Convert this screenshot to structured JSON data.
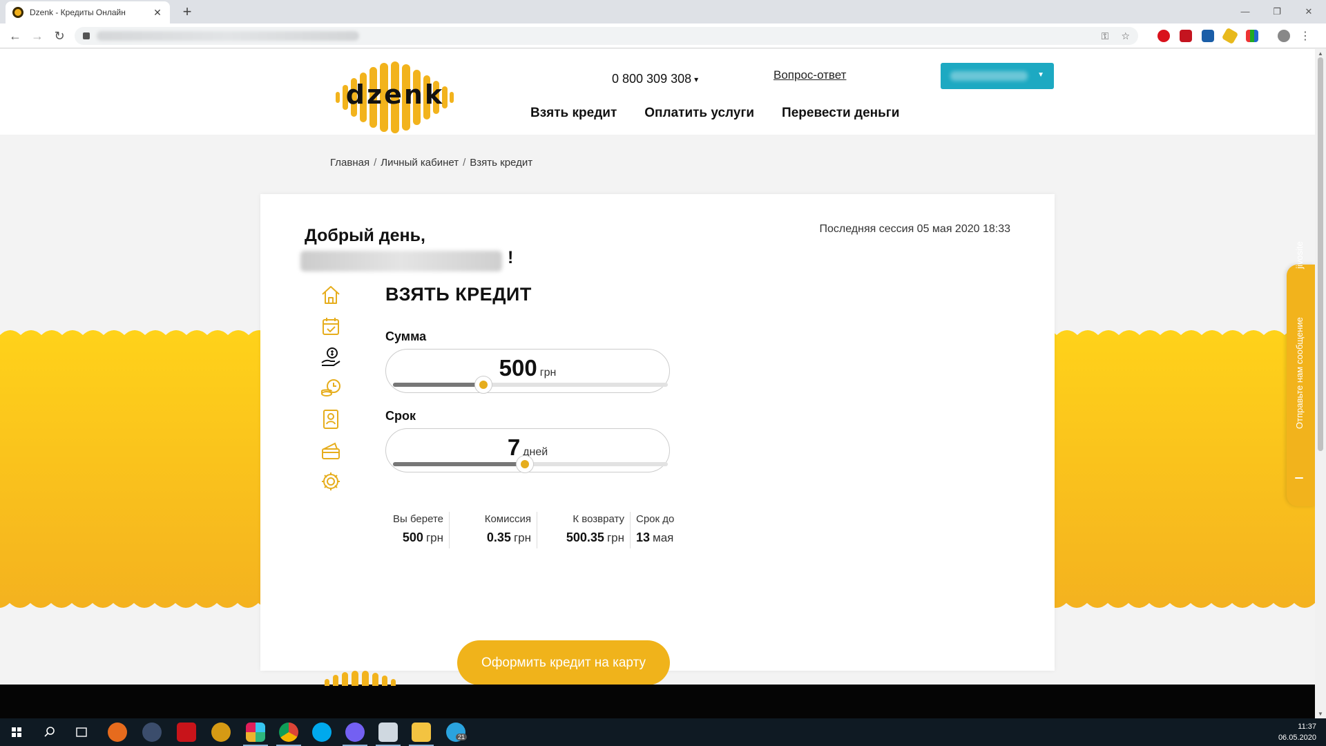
{
  "browser": {
    "tab_title": "Dzenk - Кредиты Онлайн",
    "tab_close": "✕",
    "new_tab": "+",
    "win_minimize": "—",
    "win_restore": "❐",
    "win_close": "✕",
    "back": "←",
    "forward": "→",
    "reload": "↻",
    "key_icon": "⚿",
    "star_icon": "☆",
    "menu_icon": "⋮"
  },
  "header": {
    "logo_text": "dzenk",
    "phone": "0 800 309 308",
    "phone_caret": "▾",
    "faq_link": "Вопрос-ответ",
    "user_caret": "▼",
    "nav": [
      "Взять кредит",
      "Оплатить услуги",
      "Перевести деньги"
    ]
  },
  "breadcrumb": [
    "Главная",
    "Личный кабинет",
    "Взять кредит"
  ],
  "breadcrumb_sep": "/",
  "card": {
    "greeting": "Добрый день,",
    "exclaim": "!",
    "last_session": "Последняя сессия 05 мая 2020 18:33",
    "title": "ВЗЯТЬ КРЕДИТ",
    "amount": {
      "label": "Сумма",
      "value": "500",
      "unit": "грн",
      "fill": 0.33
    },
    "term": {
      "label": "Срок",
      "value": "7",
      "unit": "дней",
      "fill": 0.48
    },
    "summary": [
      {
        "label": "Вы берете",
        "value": "500",
        "unit": "грн"
      },
      {
        "label": "Комиссия",
        "value": "0.35",
        "unit": "грн"
      },
      {
        "label": "К возврату",
        "value": "500.35",
        "unit": "грн"
      },
      {
        "label": "Срок до",
        "value": "13",
        "unit": "мая"
      }
    ],
    "cta": "Оформить кредит на карту"
  },
  "side_icons": [
    "home-icon",
    "calendar-check-icon",
    "hand-money-icon",
    "coins-clock-icon",
    "profile-card-icon",
    "wallet-card-icon",
    "gear-icon"
  ],
  "jivo": {
    "brand": "jivosite",
    "message": "Отправьте нам сообщение"
  },
  "taskbar": {
    "time": "11:37",
    "date": "06.05.2020",
    "telegram_badge": "21"
  },
  "colors": {
    "accent": "#f0b31b",
    "wave": "#f9c416",
    "user_button": "#1da9c2",
    "taskbar": "#0f1a23"
  }
}
